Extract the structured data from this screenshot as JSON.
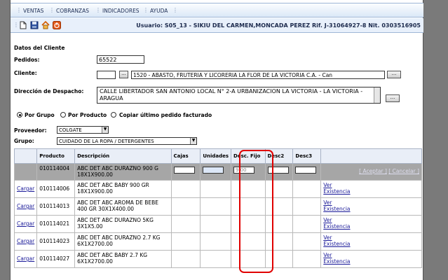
{
  "menu": {
    "items": [
      "VENTAS",
      "COBRANZAS",
      "INDICADORES",
      "AYUDA"
    ]
  },
  "toolbar": {
    "icons": [
      "new-document-icon",
      "save-icon",
      "home-icon",
      "exit-icon"
    ]
  },
  "user_info": "Usuario: S05_13 - SIKIU DEL CARMEN,MONCADA PEREZ  Rif. J-31064927-8  Nit. 0303516905",
  "section_title": "Datos del Cliente",
  "pedidos": {
    "label": "Pedidos:",
    "value": "65522"
  },
  "cliente": {
    "label": "Cliente:",
    "code": "",
    "name": "1520 - ABASTO, FRUTERIA Y LICORERIA LA FLOR DE LA VICTORIA C.A. -  Can",
    "btn": "..."
  },
  "direccion": {
    "label": "Dirección de Despacho:",
    "value": "CALLE LIBERTADOR SAN ANTONIO LOCAL N° 2-A URBANIZACION LA VICTORIA - LA VICTORIA - ARAGUA",
    "btn": "..."
  },
  "radios": {
    "grupo": "Por Grupo",
    "producto": "Por Producto",
    "copiar": "Copiar último pedido facturado"
  },
  "proveedor": {
    "label": "Proveedor:",
    "value": "COLGATE"
  },
  "grupo": {
    "label": "Grupo:",
    "value": "CUIDADO DE LA ROPA / DETERGENTES"
  },
  "table": {
    "headers": [
      "",
      "Producto",
      "Descripción",
      "Cajas",
      "Unidades",
      "Desc. Fijo",
      "Desc2",
      "Desc3",
      ""
    ],
    "edit_row": {
      "producto": "010114004",
      "descripcion": "ABC DET ABC DURAZNO 900 G 18X1X900.00",
      "desc_fijo": "9.00",
      "aceptar": "[ Aceptar ]",
      "cancelar": "[ Cancelar ]"
    },
    "rows": [
      {
        "link": "Cargar",
        "producto": "010114006",
        "descripcion": "ABC DET ABC BABY 900 GR 18X1X900.00",
        "ver": "Ver Existencia"
      },
      {
        "link": "Cargar",
        "producto": "010114013",
        "descripcion": "ABC DET ABC AROMA DE BEBE 400 GR 30X1X400.00",
        "ver": "Ver Existencia"
      },
      {
        "link": "Cargar",
        "producto": "010114021",
        "descripcion": "ABC DET ABC DURAZNO 5KG 3X1X5.00",
        "ver": "Ver Existencia"
      },
      {
        "link": "Cargar",
        "producto": "010114023",
        "descripcion": "ABC DET ABC DURAZNO 2.7 KG 6X1X2700.00",
        "ver": "Ver Existencia"
      },
      {
        "link": "Cargar",
        "producto": "010114027",
        "descripcion": "ABC DET ABC BABY 2.7 KG 6X1X2700.00",
        "ver": "Ver Existencia"
      }
    ]
  },
  "colors": {
    "highlight": "#e00000",
    "menu_text": "#1d2e55",
    "edit_row_bg": "#a6a6a6"
  }
}
